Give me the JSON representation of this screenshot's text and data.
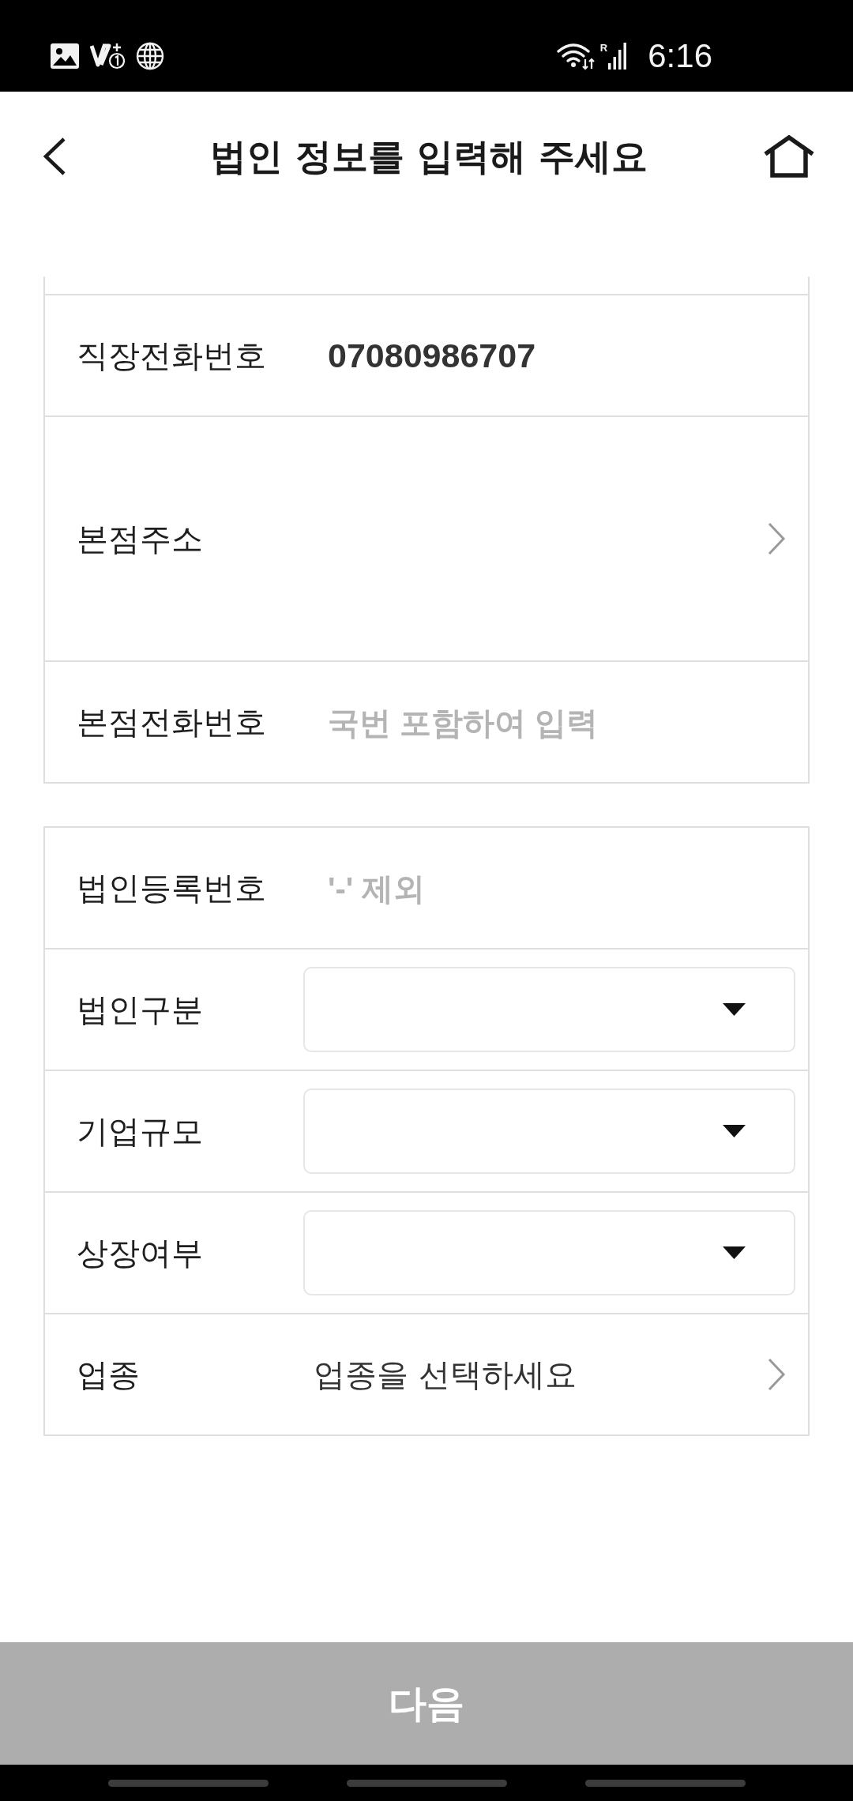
{
  "status_bar": {
    "roaming": "R",
    "time": "6:16"
  },
  "header": {
    "title": "법인 정보를 입력해 주세요"
  },
  "sections": [
    {
      "cut_off_top": true,
      "rows": [
        {
          "kind": "input",
          "label": "직장전화번호",
          "value": "07080986707"
        },
        {
          "kind": "address",
          "label": "본점주소"
        },
        {
          "kind": "input",
          "label": "본점전화번호",
          "placeholder": "국번 포함하여 입력"
        }
      ]
    },
    {
      "cut_off_top": false,
      "rows": [
        {
          "kind": "input",
          "label": "법인등록번호",
          "placeholder": "'-' 제외"
        },
        {
          "kind": "select",
          "label": "법인구분"
        },
        {
          "kind": "select",
          "label": "기업규모"
        },
        {
          "kind": "select",
          "label": "상장여부"
        },
        {
          "kind": "link",
          "label": "업종",
          "value": "업종을 선택하세요"
        }
      ]
    }
  ],
  "next_button": {
    "label": "다음",
    "disabled": true
  }
}
